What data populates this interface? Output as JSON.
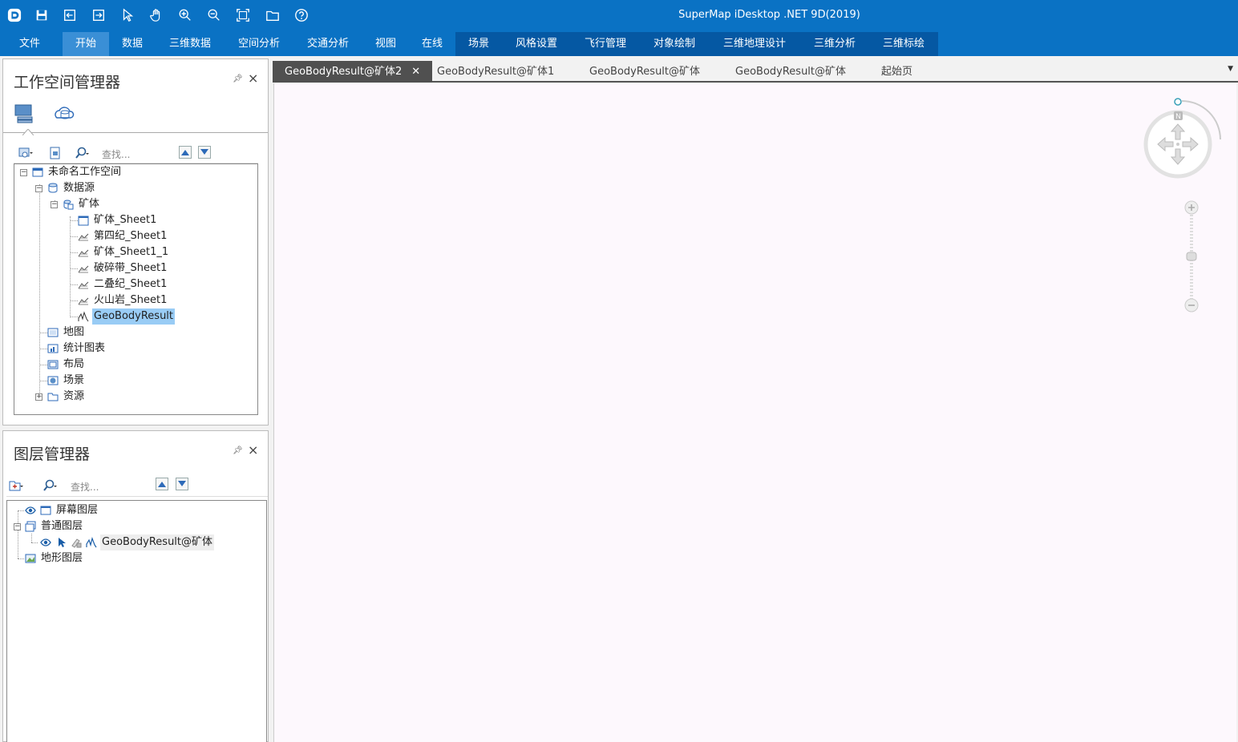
{
  "app": {
    "title": "SuperMap iDesktop .NET 9D(2019)"
  },
  "quick_access": [
    "app-logo-icon",
    "save-icon",
    "import-icon",
    "export-icon",
    "select-icon",
    "pan-icon",
    "zoom-in-icon",
    "zoom-out-icon",
    "full-extent-icon",
    "open-folder-icon",
    "help-icon"
  ],
  "menu": {
    "items": [
      "文件",
      "开始",
      "数据",
      "三维数据",
      "空间分析",
      "交通分析",
      "视图",
      "在线",
      "场景",
      "风格设置",
      "飞行管理",
      "对象绘制",
      "三维地理设计",
      "三维分析",
      "三维标绘"
    ],
    "active": "开始"
  },
  "workspace_panel": {
    "title": "工作空间管理器",
    "search_placeholder": "查找...",
    "tree": {
      "root": "未命名工作空间",
      "datasources": "数据源",
      "datasource_name": "矿体",
      "datasets": [
        "矿体_Sheet1",
        "第四纪_Sheet1",
        "矿体_Sheet1_1",
        "破碎带_Sheet1",
        "二叠纪_Sheet1",
        "火山岩_Sheet1",
        "GeoBodyResult"
      ],
      "maps": "地图",
      "charts": "统计图表",
      "layouts": "布局",
      "scenes": "场景",
      "resources": "资源"
    },
    "selected": "GeoBodyResult"
  },
  "layer_panel": {
    "title": "图层管理器",
    "search_placeholder": "查找...",
    "layers": {
      "screen": "屏幕图层",
      "normal": "普通图层",
      "normal_child": "GeoBodyResult@矿体",
      "terrain": "地形图层"
    }
  },
  "tabs": [
    {
      "label": "GeoBodyResult@矿体2",
      "active": true
    },
    {
      "label": "GeoBodyResult@矿体1",
      "active": false
    },
    {
      "label": "GeoBodyResult@矿体",
      "active": false
    },
    {
      "label": "GeoBodyResult@矿体",
      "active": false
    },
    {
      "label": "起始页",
      "active": false
    }
  ],
  "scene": {
    "compass_north": "N"
  },
  "colors": {
    "ribbon": "#0a72c4",
    "context_tabs": "#0558a3",
    "selection": "#99ccf5",
    "scene_bg": "#fdf8fd"
  }
}
